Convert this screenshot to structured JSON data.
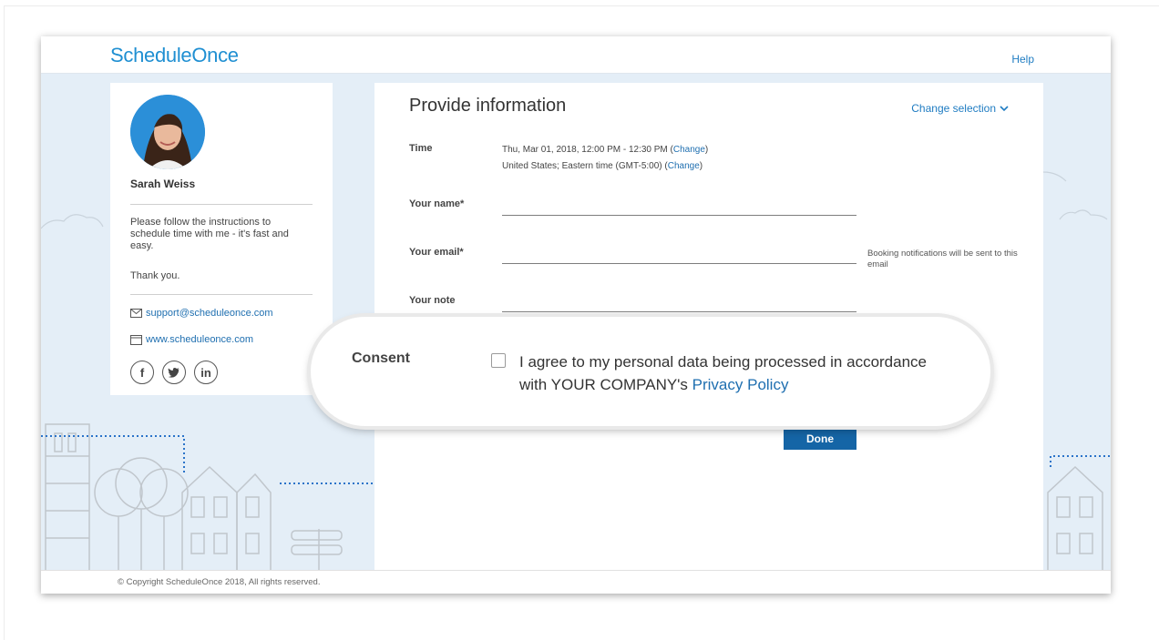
{
  "header": {
    "logo": "ScheduleOnce",
    "help": "Help"
  },
  "profile": {
    "name": "Sarah Weiss",
    "message": "Please follow the instructions to schedule time with me - it's fast and easy.",
    "thanks": "Thank you.",
    "email": "support@scheduleonce.com",
    "website": "www.scheduleonce.com",
    "socials": [
      "f",
      "t",
      "in"
    ]
  },
  "form": {
    "title": "Provide information",
    "change_selection": "Change selection",
    "time_label": "Time",
    "time_line1": "Thu, Mar 01, 2018, 12:00 PM - 12:30 PM (",
    "time_line2": "United States; Eastern time (GMT-5:00) (",
    "change_link": "Change",
    "close_paren": ")",
    "name_label": "Your name*",
    "email_label": "Your email*",
    "email_note": "Booking notifications will be sent to this email",
    "note_label": "Your note",
    "done": "Done"
  },
  "consent": {
    "label": "Consent",
    "text": "I agree to my personal data being processed in accordance with YOUR COMPANY's ",
    "link": "Privacy Policy"
  },
  "footer": {
    "copyright": "© Copyright ScheduleOnce 2018, All rights reserved."
  },
  "colors": {
    "accent": "#1f7cc2",
    "button": "#1565a6",
    "background": "#e4eef7"
  }
}
